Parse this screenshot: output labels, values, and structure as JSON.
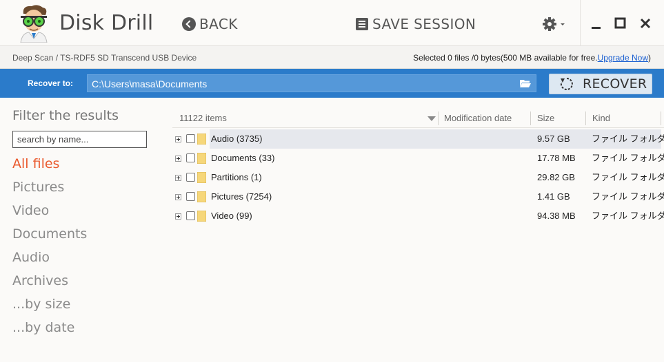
{
  "app": {
    "title": "Disk Drill"
  },
  "toolbar": {
    "back_label": "BACK",
    "save_session_label": "SAVE SESSION"
  },
  "infobar": {
    "breadcrumb": "Deep Scan / TS-RDF5 SD  Transcend USB Device",
    "selected_text": "Selected 0 files /0 bytes(500 MB available for free.",
    "upgrade_link": "Upgrade Now",
    "closing_paren": ")"
  },
  "recover": {
    "label": "Recover to:",
    "path": "C:\\Users\\masa\\Documents",
    "button_label": "RECOVER"
  },
  "sidebar": {
    "title": "Filter the results",
    "search_placeholder": "search by name...",
    "filters": [
      "All files",
      "Pictures",
      "Video",
      "Documents",
      "Audio",
      "Archives",
      "...by size",
      "...by date"
    ],
    "active_filter_index": 0
  },
  "table": {
    "headers": {
      "items": "11122 items",
      "modified": "Modification date",
      "size": "Size",
      "kind": "Kind"
    },
    "rows": [
      {
        "name": "Audio",
        "count": "(3735)",
        "size": "9.57 GB",
        "kind": "ファイル フォルダー"
      },
      {
        "name": "Documents",
        "count": "(33)",
        "size": "17.78 MB",
        "kind": "ファイル フォルダー"
      },
      {
        "name": "Partitions",
        "count": "(1)",
        "size": "29.82 GB",
        "kind": "ファイル フォルダー"
      },
      {
        "name": "Pictures",
        "count": "(7254)",
        "size": "1.41 GB",
        "kind": "ファイル フォルダー"
      },
      {
        "name": "Video",
        "count": "(99)",
        "size": "94.38 MB",
        "kind": "ファイル フォルダー"
      }
    ],
    "highlighted_row_index": 0
  },
  "colors": {
    "accent_blue": "#2b7bca",
    "active_filter": "#ea5a2e",
    "folder_yellow": "#f6d77a"
  },
  "icons": {
    "back": "back-arrow-icon",
    "save": "list-icon",
    "settings": "gear-icon",
    "minimize": "minimize-icon",
    "maximize": "maximize-icon",
    "close": "close-icon",
    "browse": "folder-open-icon",
    "recover": "refresh-icon",
    "row_folder": "folder-icon",
    "expand": "expand-plus-icon"
  }
}
